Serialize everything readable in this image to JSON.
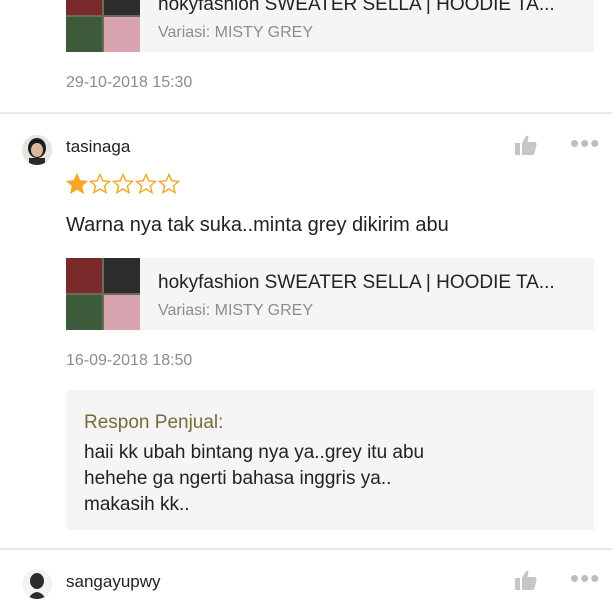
{
  "review1": {
    "product": {
      "name": "hokyfashion  SWEATER SELLA | HOODIE TA...",
      "variant": "Variasi: MISTY GREY"
    },
    "date": "29-10-2018 15:30"
  },
  "review2": {
    "username": "tasinaga",
    "rating": 1,
    "max_rating": 5,
    "comment": "Warna nya tak suka..minta grey dikirim abu",
    "product": {
      "name": "hokyfashion  SWEATER SELLA | HOODIE TA...",
      "variant": "Variasi: MISTY GREY"
    },
    "date": "16-09-2018 18:50",
    "seller_reply": {
      "title": "Respon Penjual:",
      "text": "haii kk ubah bintang nya ya..grey itu abu\nhehehe ga ngerti bahasa inggris ya..\nmakasih kk.."
    }
  },
  "review3": {
    "username": "sangayupwy"
  },
  "icons": {
    "like": "thumbs-up-icon",
    "more": "more-dots-icon",
    "star": "star-icon"
  },
  "colors": {
    "star": "#f5a623",
    "star_empty_stroke": "#f5a623",
    "muted_text": "#8c8c8c",
    "reply_title": "#7a6a3a"
  }
}
